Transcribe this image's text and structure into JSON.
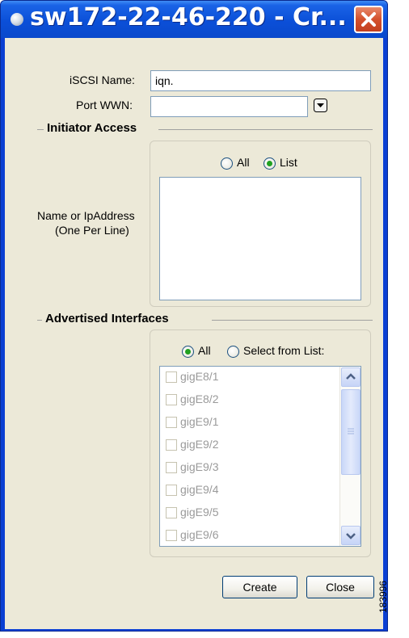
{
  "window": {
    "title": "sw172-22-46-220 - Cr...",
    "icon": "globe-icon",
    "close_icon": "close-icon",
    "accent": "#0b4fd8"
  },
  "form": {
    "iscsi_name_label": "iSCSI Name:",
    "iscsi_name_value": "iqn.",
    "port_wwn_label": "Port WWN:",
    "port_wwn_value": "",
    "port_wwn_icon": "chevron-down-icon"
  },
  "initiator_access": {
    "title": "Initiator Access",
    "radio_all": "All",
    "radio_list": "List",
    "selected": "List",
    "name_label_line1": "Name or IpAddress",
    "name_label_line2": "(One Per Line)",
    "names_value": ""
  },
  "advertised_interfaces": {
    "title": "Advertised Interfaces",
    "radio_all": "All",
    "radio_select": "Select from List:",
    "selected": "All",
    "items": [
      {
        "label": "gigE8/1",
        "checked": false
      },
      {
        "label": "gigE8/2",
        "checked": false
      },
      {
        "label": "gigE9/1",
        "checked": false
      },
      {
        "label": "gigE9/2",
        "checked": false
      },
      {
        "label": "gigE9/3",
        "checked": false
      },
      {
        "label": "gigE9/4",
        "checked": false
      },
      {
        "label": "gigE9/5",
        "checked": false
      },
      {
        "label": "gigE9/6",
        "checked": false
      }
    ]
  },
  "buttons": {
    "create": "Create",
    "close": "Close"
  },
  "figure_id": "183996"
}
